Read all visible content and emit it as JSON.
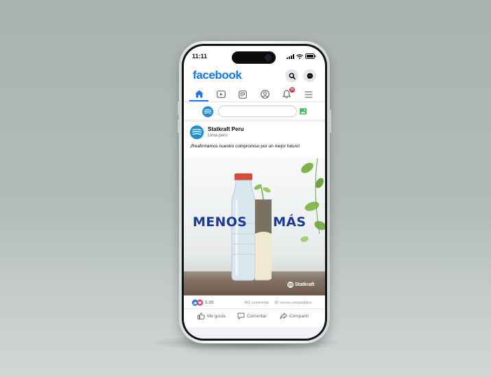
{
  "status_bar": {
    "time": "11:11"
  },
  "header": {
    "logo": "facebook",
    "search_icon": "search-icon",
    "messenger_icon": "messenger-icon"
  },
  "tabs": [
    {
      "name": "home",
      "icon": "home-icon",
      "active": true
    },
    {
      "name": "watch",
      "icon": "video-icon",
      "active": false
    },
    {
      "name": "feeds",
      "icon": "feeds-icon",
      "active": false
    },
    {
      "name": "profile",
      "icon": "profile-icon",
      "active": false
    },
    {
      "name": "notifications",
      "icon": "bell-icon",
      "active": false,
      "badge": "10"
    },
    {
      "name": "menu",
      "icon": "menu-icon",
      "active": false
    }
  ],
  "composer": {
    "placeholder": ""
  },
  "post": {
    "author": "Statkraft Peru",
    "location": "Lima perú",
    "text": "¡Reafirmamos nuestro compromiso por un mejor futuro!",
    "image": {
      "headline_left": "MENOS",
      "headline_right": "MÁS",
      "brand": "Statkraft"
    },
    "reactions_count": "5.8K",
    "comments": "451 comments",
    "shares": "1K veces compartidos",
    "actions": {
      "like": "Me gusta",
      "comment": "Comentar",
      "share": "Compartir"
    }
  },
  "colors": {
    "brand_blue": "#1877f2",
    "headline_blue": "#1b3a9a",
    "badge_red": "#e41e3f"
  }
}
